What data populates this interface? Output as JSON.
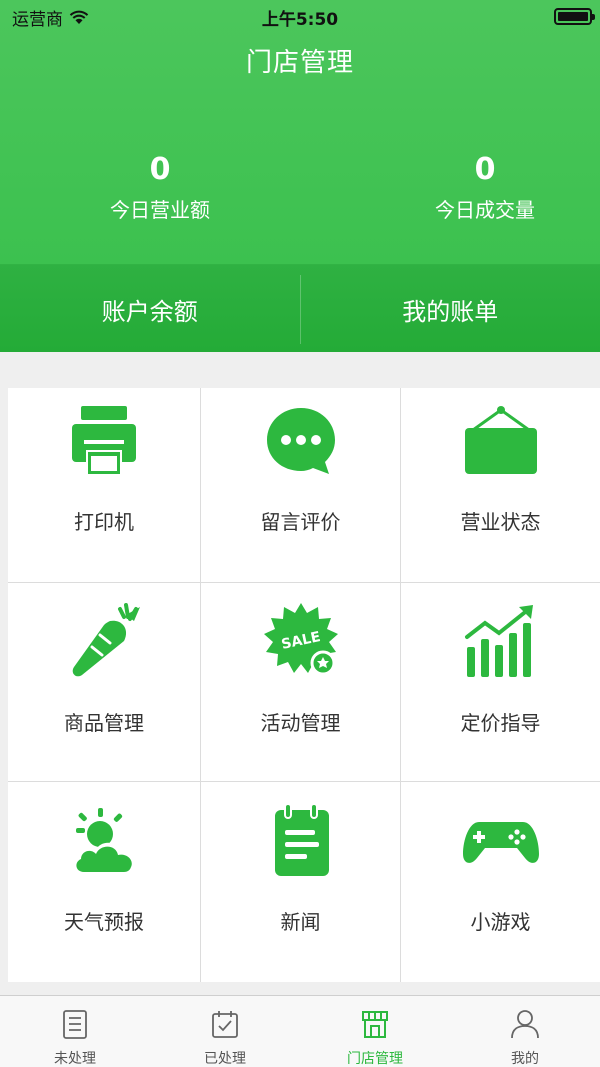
{
  "status_bar": {
    "carrier": "运营商",
    "time": "上午5:50"
  },
  "header": {
    "title": "门店管理",
    "stats": [
      {
        "value": "0",
        "label": "今日营业额"
      },
      {
        "value": "0",
        "label": "今日成交量"
      }
    ],
    "buttons": [
      {
        "label": "账户余额"
      },
      {
        "label": "我的账单"
      }
    ]
  },
  "grid": [
    {
      "label": "打印机",
      "icon": "printer-icon"
    },
    {
      "label": "留言评价",
      "icon": "chat-bubble-icon"
    },
    {
      "label": "营业状态",
      "icon": "hanging-sign-icon"
    },
    {
      "label": "商品管理",
      "icon": "carrot-icon"
    },
    {
      "label": "活动管理",
      "icon": "sale-badge-icon"
    },
    {
      "label": "定价指导",
      "icon": "growth-chart-icon"
    },
    {
      "label": "天气预报",
      "icon": "weather-icon"
    },
    {
      "label": "新闻",
      "icon": "notepad-icon"
    },
    {
      "label": "小游戏",
      "icon": "gamepad-icon"
    }
  ],
  "tabbar": {
    "items": [
      {
        "label": "未处理",
        "icon": "list-icon"
      },
      {
        "label": "已处理",
        "icon": "calendar-check-icon"
      },
      {
        "label": "门店管理",
        "icon": "store-icon",
        "active": true
      },
      {
        "label": "我的",
        "icon": "user-icon"
      }
    ]
  },
  "colors": {
    "brand": "#3cc14f",
    "brand_dark": "#24ab37",
    "icon_green": "#2db83f"
  }
}
